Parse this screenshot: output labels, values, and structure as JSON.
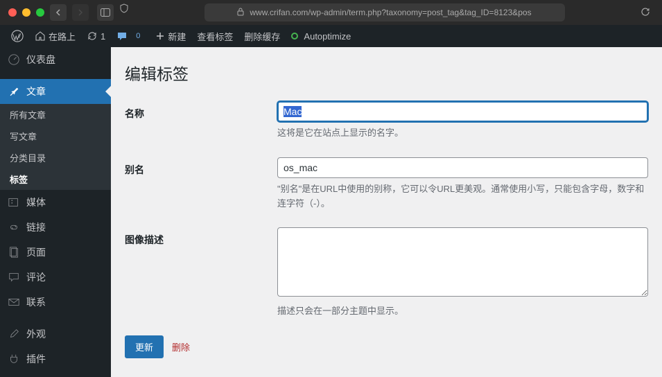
{
  "browser": {
    "url": "www.crifan.com/wp-admin/term.php?taxonomy=post_tag&tag_ID=8123&pos"
  },
  "adminbar": {
    "site_name": "在路上",
    "updates_count": "1",
    "comments_count": "0",
    "new_label": "新建",
    "view_tag_label": "查看标签",
    "delete_cache_label": "删除缓存",
    "autoptimize_label": "Autoptimize"
  },
  "sidebar": {
    "items": [
      {
        "label": "仪表盘",
        "icon": "dashboard"
      },
      {
        "label": "文章",
        "icon": "posts",
        "current": true
      },
      {
        "label": "媒体",
        "icon": "media"
      },
      {
        "label": "链接",
        "icon": "links"
      },
      {
        "label": "页面",
        "icon": "pages"
      },
      {
        "label": "评论",
        "icon": "comments"
      },
      {
        "label": "联系",
        "icon": "contact"
      },
      {
        "label": "外观",
        "icon": "appearance"
      },
      {
        "label": "插件",
        "icon": "plugins"
      }
    ],
    "submenu": [
      {
        "label": "所有文章"
      },
      {
        "label": "写文章"
      },
      {
        "label": "分类目录"
      },
      {
        "label": "标签",
        "current": true
      }
    ]
  },
  "page": {
    "title": "编辑标签",
    "name_label": "名称",
    "name_value": "Mac",
    "name_desc": "这将是它在站点上显示的名字。",
    "slug_label": "别名",
    "slug_value": "os_mac",
    "slug_desc": "\"别名\"是在URL中使用的别称，它可以令URL更美观。通常使用小写，只能包含字母，数字和连字符（-）。",
    "desc_label": "图像描述",
    "desc_value": "",
    "desc_desc": "描述只会在一部分主题中显示。",
    "update_btn": "更新",
    "delete_btn": "删除"
  }
}
